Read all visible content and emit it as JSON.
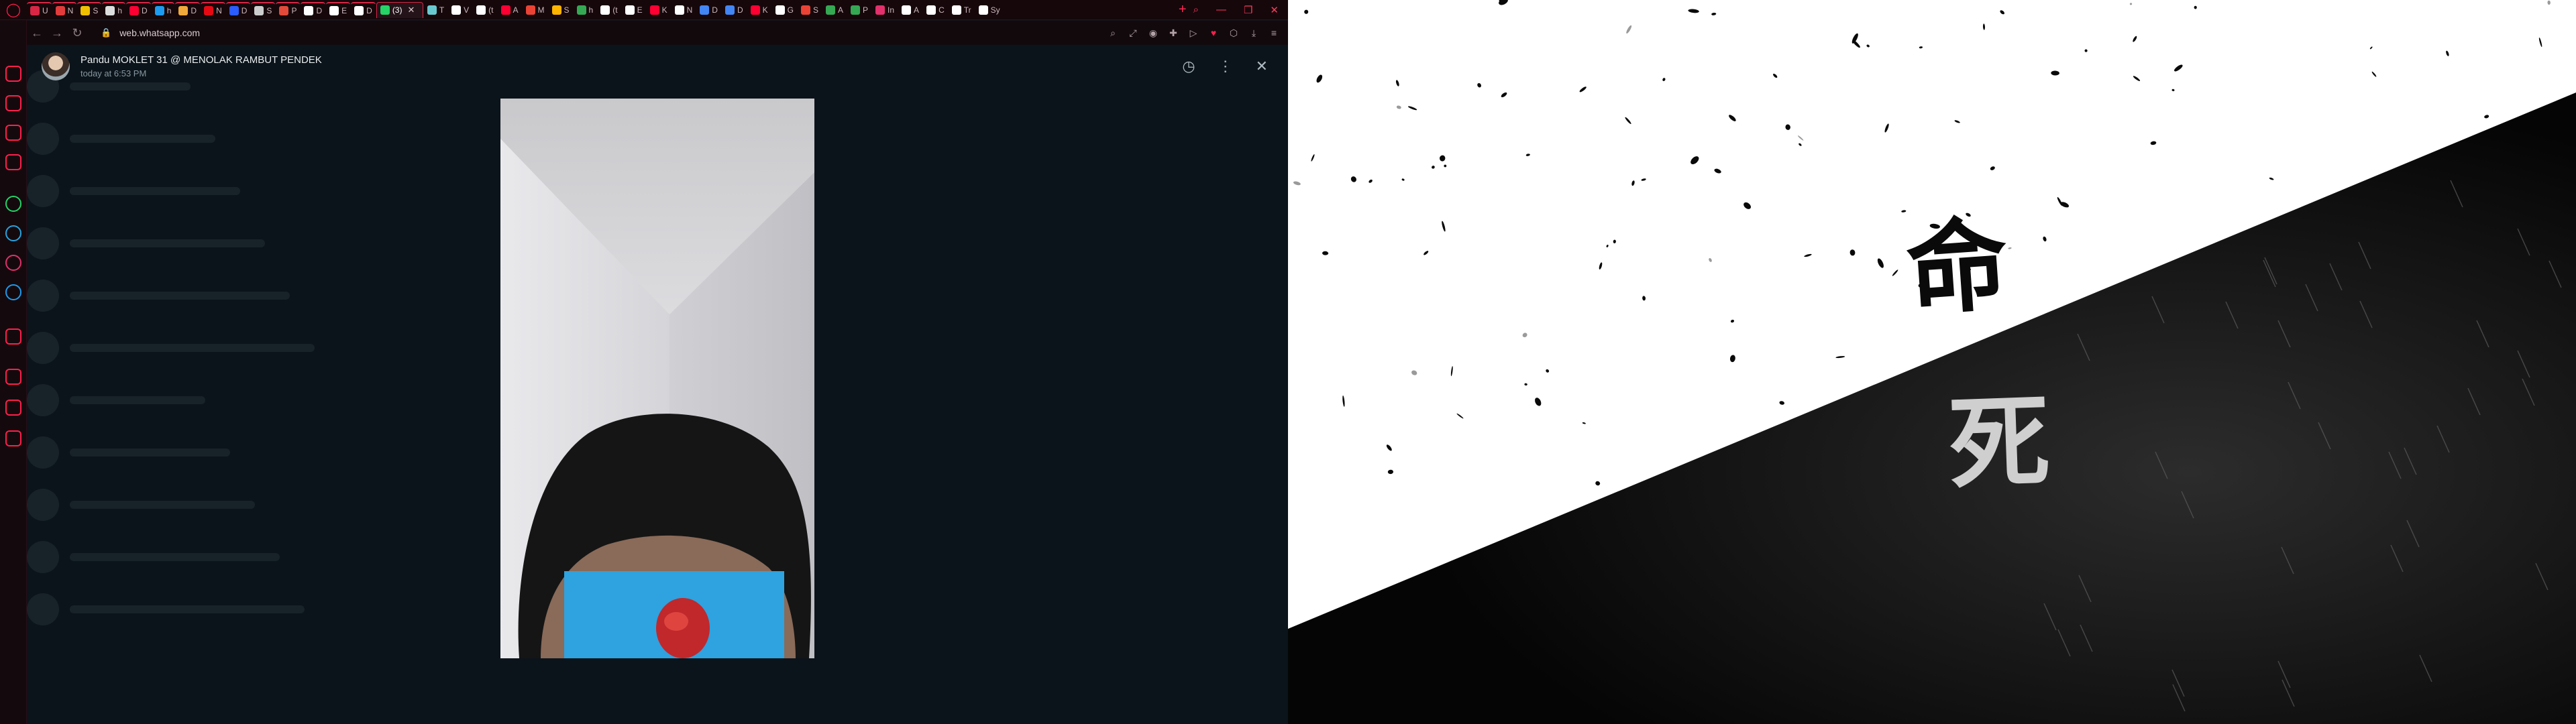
{
  "browser": {
    "name": "Opera GX",
    "accent": "#ff1f4b",
    "tabs": [
      {
        "label": "U",
        "color": "#d92645"
      },
      {
        "label": "N",
        "color": "#e23b3b"
      },
      {
        "label": "S",
        "color": "#f0c000"
      },
      {
        "label": "h",
        "color": "#dddddd"
      },
      {
        "label": "D",
        "color": "#ff0033"
      },
      {
        "label": "h",
        "color": "#1d9bf0"
      },
      {
        "label": "D",
        "color": "#f2a93b"
      },
      {
        "label": "N",
        "color": "#e50914"
      },
      {
        "label": "D",
        "color": "#2a5cff"
      },
      {
        "label": "S",
        "color": "#cccccc"
      },
      {
        "label": "P",
        "color": "#e34a3a"
      },
      {
        "label": "D",
        "color": "#ffffff"
      },
      {
        "label": "E",
        "color": "#ffffff"
      },
      {
        "label": "D",
        "color": "#ffffff"
      },
      {
        "label": "(",
        "color": "#25d366"
      },
      {
        "label": "T",
        "color": "#69c9d0"
      },
      {
        "label": "V",
        "color": "#ffffff"
      },
      {
        "label": "(t",
        "color": "#ffffff"
      },
      {
        "label": "A",
        "color": "#ff0033"
      },
      {
        "label": "M",
        "color": "#ea4335"
      },
      {
        "label": "S",
        "color": "#ffb400"
      },
      {
        "label": "h",
        "color": "#34a853"
      },
      {
        "label": "(t",
        "color": "#ffffff"
      },
      {
        "label": "E",
        "color": "#ffffff"
      },
      {
        "label": "K",
        "color": "#ff0033"
      },
      {
        "label": "N",
        "color": "#ffffff"
      },
      {
        "label": "D",
        "color": "#4285f4"
      },
      {
        "label": "D",
        "color": "#4285f4"
      },
      {
        "label": "K",
        "color": "#ff0033"
      },
      {
        "label": "G",
        "color": "#ffffff"
      },
      {
        "label": "S",
        "color": "#ea4335"
      },
      {
        "label": "A",
        "color": "#34a853"
      },
      {
        "label": "P",
        "color": "#34a853"
      },
      {
        "label": "In",
        "color": "#e1306c"
      },
      {
        "label": "A",
        "color": "#ffffff"
      },
      {
        "label": "C",
        "color": "#ffffff"
      },
      {
        "label": "Tr",
        "color": "#ffffff"
      },
      {
        "label": "Sy",
        "color": "#ffffff"
      }
    ],
    "active_tab_label": "(3)",
    "active_tab_close": "✕",
    "new_tab": "+",
    "url": "web.whatsapp.com",
    "lock_icon": "🔒",
    "nav": {
      "back": "←",
      "forward": "→",
      "reload": "↻"
    },
    "toolbar_icons": [
      "⌕",
      "⤢",
      "◉",
      "✚",
      "▷",
      "♥",
      "⬡",
      "⤓",
      "≡"
    ],
    "window_controls": {
      "search": "⌕",
      "minimize": "—",
      "restore": "❐",
      "close": "✕"
    },
    "sidebar_icons": [
      {
        "name": "messenger",
        "color": "#ff1f4b"
      },
      {
        "name": "speed-dial",
        "color": "#ff1f4b"
      },
      {
        "name": "shopping",
        "color": "#ff1f4b"
      },
      {
        "name": "twitch",
        "color": "#ff1f4b"
      },
      {
        "name": "whatsapp",
        "color": "#25d366"
      },
      {
        "name": "telegram",
        "color": "#2aa3e0"
      },
      {
        "name": "instagram",
        "color": "#e1306c"
      },
      {
        "name": "twitter",
        "color": "#1d9bf0"
      },
      {
        "name": "player",
        "color": "#ff1f4b"
      },
      {
        "name": "history",
        "color": "#ff1f4b"
      },
      {
        "name": "extensions",
        "color": "#ff1f4b"
      },
      {
        "name": "settings",
        "color": "#ff1f4b"
      }
    ]
  },
  "viewer": {
    "sender_name": "Pandu MOKLET 31 @ MENOLAK RAMBUT PENDEK",
    "timestamp": "today at 6:53 PM",
    "actions": {
      "emoji_label": "◷",
      "menu_label": "⋮",
      "close_label": "✕"
    }
  },
  "wallpaper": {
    "kanji_top": "命",
    "kanji_bottom": "死"
  }
}
